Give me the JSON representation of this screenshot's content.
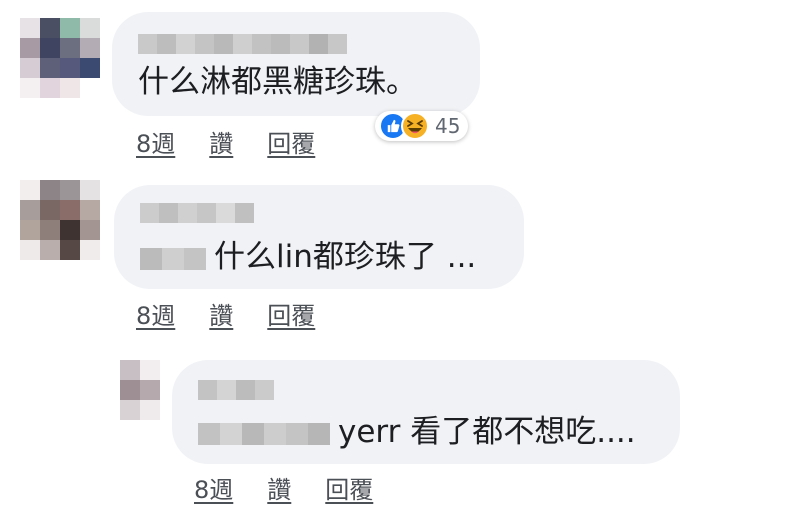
{
  "colors": {
    "bubble": "#f0f2f5",
    "text": "#1c1e21",
    "action": "#4b4f56",
    "like": "#1877f2",
    "haha": "#f7b125"
  },
  "comments": [
    {
      "text": "什么淋都黑糖珍珠。",
      "time": "8週",
      "like": "讚",
      "reply": "回覆",
      "reactions": {
        "icons": [
          "like-icon",
          "haha-icon"
        ],
        "count": "45"
      }
    },
    {
      "text": "什么lin都珍珠了 ...",
      "time": "8週",
      "like": "讚",
      "reply": "回覆"
    },
    {
      "text": "yerr 看了都不想吃....",
      "time": "8週",
      "like": "讚",
      "reply": "回覆"
    }
  ]
}
